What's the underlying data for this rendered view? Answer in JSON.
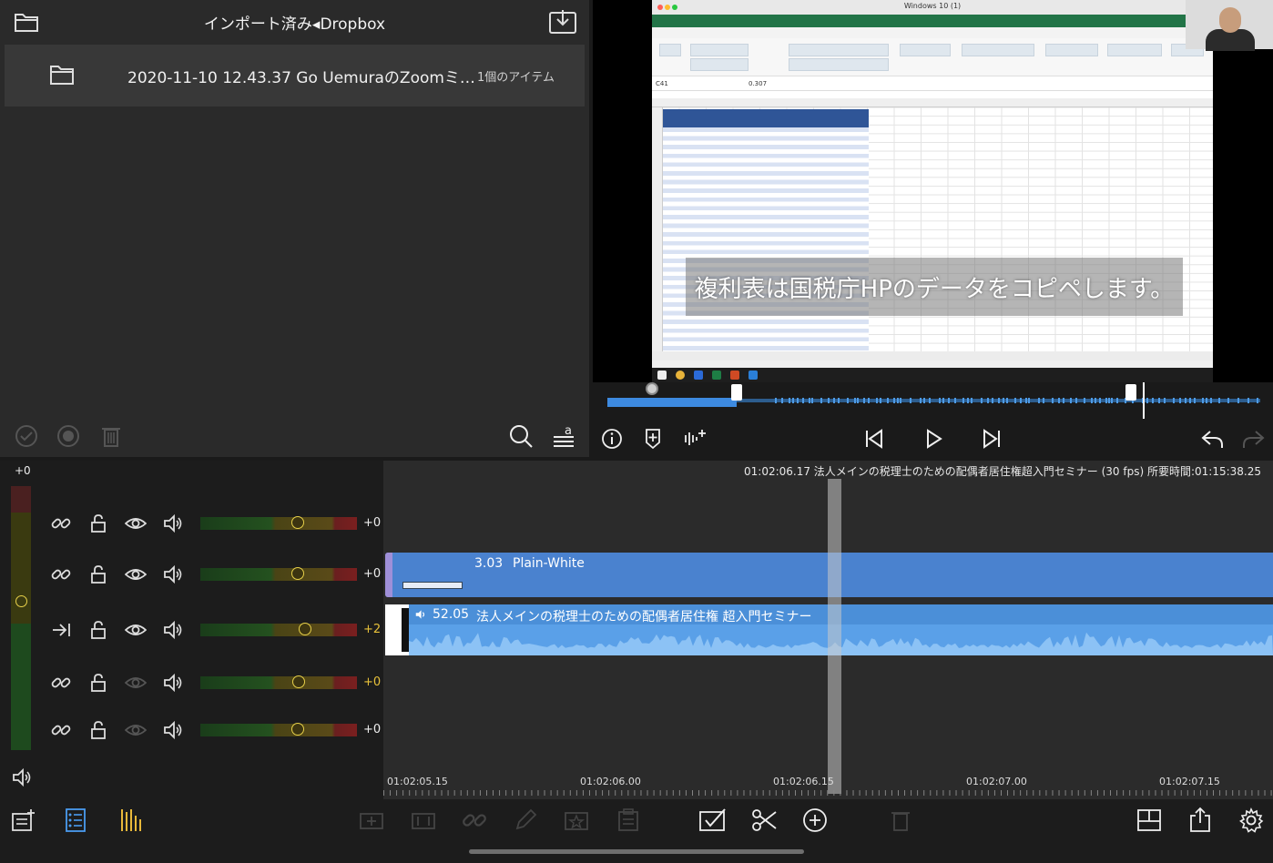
{
  "browser": {
    "title": "インポート済み◂Dropbox",
    "items": [
      {
        "name": "2020-11-10 12.43.37 Go UemuraのZoomミ…",
        "count": "1個のアイテム"
      }
    ]
  },
  "viewer": {
    "window_title": "Windows 10 (1)",
    "cell_ref": "C41",
    "formula_value": "0.307",
    "subtitle": "複利表は国税庁HPのデータをコピペします。"
  },
  "tracks": {
    "master_gain": "+0",
    "rows": [
      {
        "value": "+0",
        "level": 0.62,
        "warn": false,
        "link_icon": "link-icon",
        "visible": true
      },
      {
        "value": "+0",
        "level": 0.62,
        "warn": false,
        "link_icon": "link-icon",
        "visible": true
      },
      {
        "value": "+2",
        "level": 0.67,
        "warn": true,
        "link_icon": "attach-arrow-icon",
        "visible": true
      },
      {
        "value": "+0",
        "level": 0.63,
        "warn": true,
        "link_icon": "link-icon",
        "visible": false
      },
      {
        "value": "+0",
        "level": 0.62,
        "warn": false,
        "link_icon": "link-icon",
        "visible": false
      }
    ]
  },
  "timeline": {
    "info": "01:02:06.17 法人メインの税理士のための配偶者居住権超入門セミナー (30 fps) 所要時間:01:15:38.25",
    "title_clip": {
      "duration": "3.03",
      "name": "Plain-White"
    },
    "av_clip": {
      "duration": "52.05",
      "name": "法人メインの税理士のための配偶者居住権 超入門セミナー"
    },
    "ruler": [
      "01:02:05.15",
      "01:02:06.00",
      "01:02:06.15",
      "01:02:07.00",
      "01:02:07.15"
    ]
  },
  "colors": {
    "accent": "#4a82cf",
    "clip_audio": "#5aa0e8",
    "warn_value": "#e8c23a",
    "title_handle": "#9f8fd8"
  }
}
